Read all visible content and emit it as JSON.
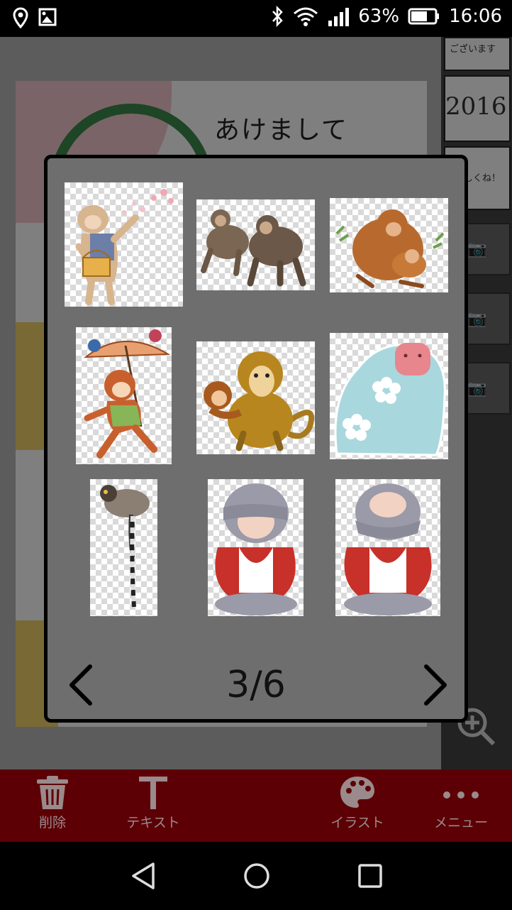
{
  "status_bar": {
    "battery": "63%",
    "time": "16:06"
  },
  "background": {
    "card_greeting": "あけまして",
    "thumbs": [
      {
        "text": "ございます"
      },
      {
        "text": "2016"
      },
      {
        "text": "よろしくね！"
      }
    ]
  },
  "dialog": {
    "page_indicator": "3/6",
    "illustrations": [
      {
        "name": "monkey-basket"
      },
      {
        "name": "monkeys-walking"
      },
      {
        "name": "monkey-mother-child"
      },
      {
        "name": "monkey-umbrella"
      },
      {
        "name": "monkey-father-child"
      },
      {
        "name": "blue-snow-monkey"
      },
      {
        "name": "ring-tailed-lemur"
      },
      {
        "name": "see-no-evil-monkey"
      },
      {
        "name": "speak-no-evil-monkey"
      }
    ]
  },
  "toolbar": {
    "delete_label": "削除",
    "text_label": "テキスト",
    "illust_label": "イラスト",
    "menu_label": "メニュー"
  }
}
